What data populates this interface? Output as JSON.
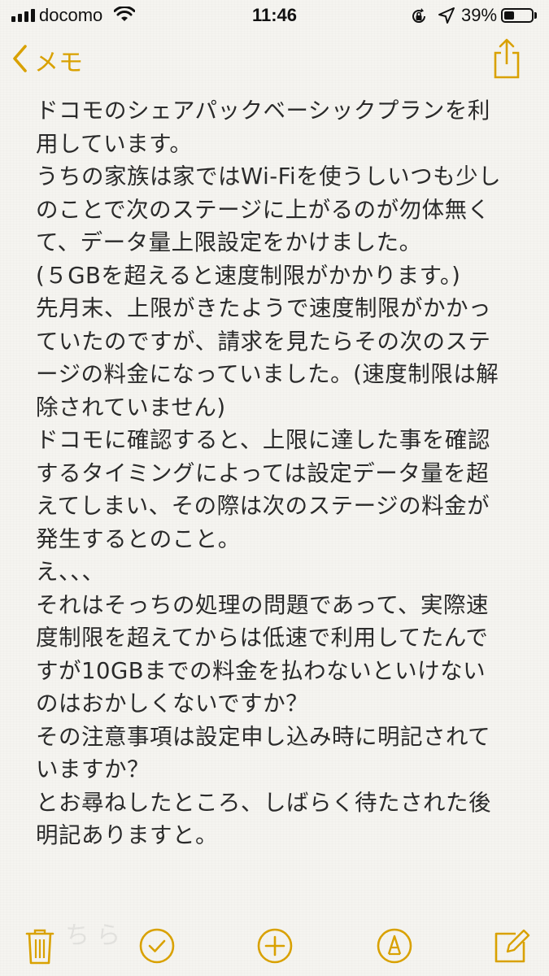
{
  "status_bar": {
    "carrier": "docomo",
    "time": "11:46",
    "battery_percent": "39%",
    "battery_level": 0.39
  },
  "nav": {
    "back_label": "メモ"
  },
  "note": {
    "lines": [
      "ドコモのシェアパックベーシックプランを利",
      "用しています。",
      "うちの家族は家ではWi-Fiを使うしいつも少し",
      "のことで次のステージに上がるのが勿体無く",
      "て、データ量上限設定をかけました。",
      "(５GBを超えると速度制限がかかります。)",
      "先月末、上限がきたようで速度制限がかかっ",
      "ていたのですが、請求を見たらその次のステ",
      "ージの料金になっていました。(速度制限は解",
      "除されていません)",
      "ドコモに確認すると、上限に達した事を確認",
      "するタイミングによっては設定データ量を超",
      "えてしまい、その際は次のステージの料金が",
      "発生するとのこと。",
      "え、、、",
      "それはそっちの処理の問題であって、実際速",
      "度制限を超えてからは低速で利用してたんで",
      "すが10GBまでの料金を払わないといけない",
      "のはおかしくないですか？",
      "その注意事項は設定申し込み時に明記されて",
      "いますか？",
      "とお尋ねしたところ、しばらく待たされた後",
      "明記ありますと。"
    ]
  },
  "colors": {
    "accent": "#d9a100",
    "text": "#2a2a2a",
    "background": "#f5f4f0"
  },
  "toolbar": {
    "icons": [
      "trash-icon",
      "checklist-icon",
      "add-icon",
      "markup-icon",
      "compose-icon"
    ]
  }
}
